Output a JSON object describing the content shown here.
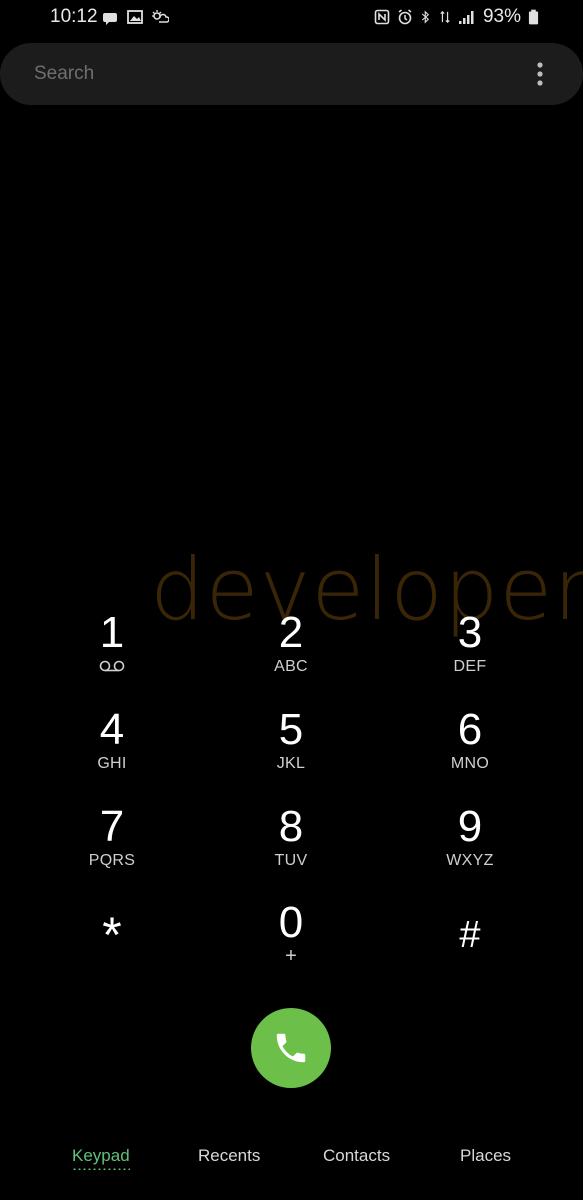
{
  "status_bar": {
    "time": "10:12",
    "battery": "93%",
    "left_icons": [
      "chat-notification-icon",
      "image-icon",
      "weather-icon"
    ],
    "right_icons": [
      "nfc-icon",
      "alarm-icon",
      "bluetooth-icon",
      "data-arrows-icon",
      "signal-icon",
      "battery-icon"
    ]
  },
  "search": {
    "placeholder": "Search"
  },
  "watermark": "developers",
  "keypad": {
    "keys": [
      {
        "digit": "1",
        "letters": ""
      },
      {
        "digit": "2",
        "letters": "ABC"
      },
      {
        "digit": "3",
        "letters": "DEF"
      },
      {
        "digit": "4",
        "letters": "GHI"
      },
      {
        "digit": "5",
        "letters": "JKL"
      },
      {
        "digit": "6",
        "letters": "MNO"
      },
      {
        "digit": "7",
        "letters": "PQRS"
      },
      {
        "digit": "8",
        "letters": "TUV"
      },
      {
        "digit": "9",
        "letters": "WXYZ"
      },
      {
        "digit": "*",
        "letters": ""
      },
      {
        "digit": "0",
        "letters": "+"
      },
      {
        "digit": "#",
        "letters": ""
      }
    ]
  },
  "tabs": [
    {
      "label": "Keypad",
      "active": true
    },
    {
      "label": "Recents",
      "active": false
    },
    {
      "label": "Contacts",
      "active": false
    },
    {
      "label": "Places",
      "active": false
    }
  ],
  "colors": {
    "call_button": "#6cc04a",
    "active_tab": "#5fc27a",
    "watermark": "#3a2607"
  }
}
